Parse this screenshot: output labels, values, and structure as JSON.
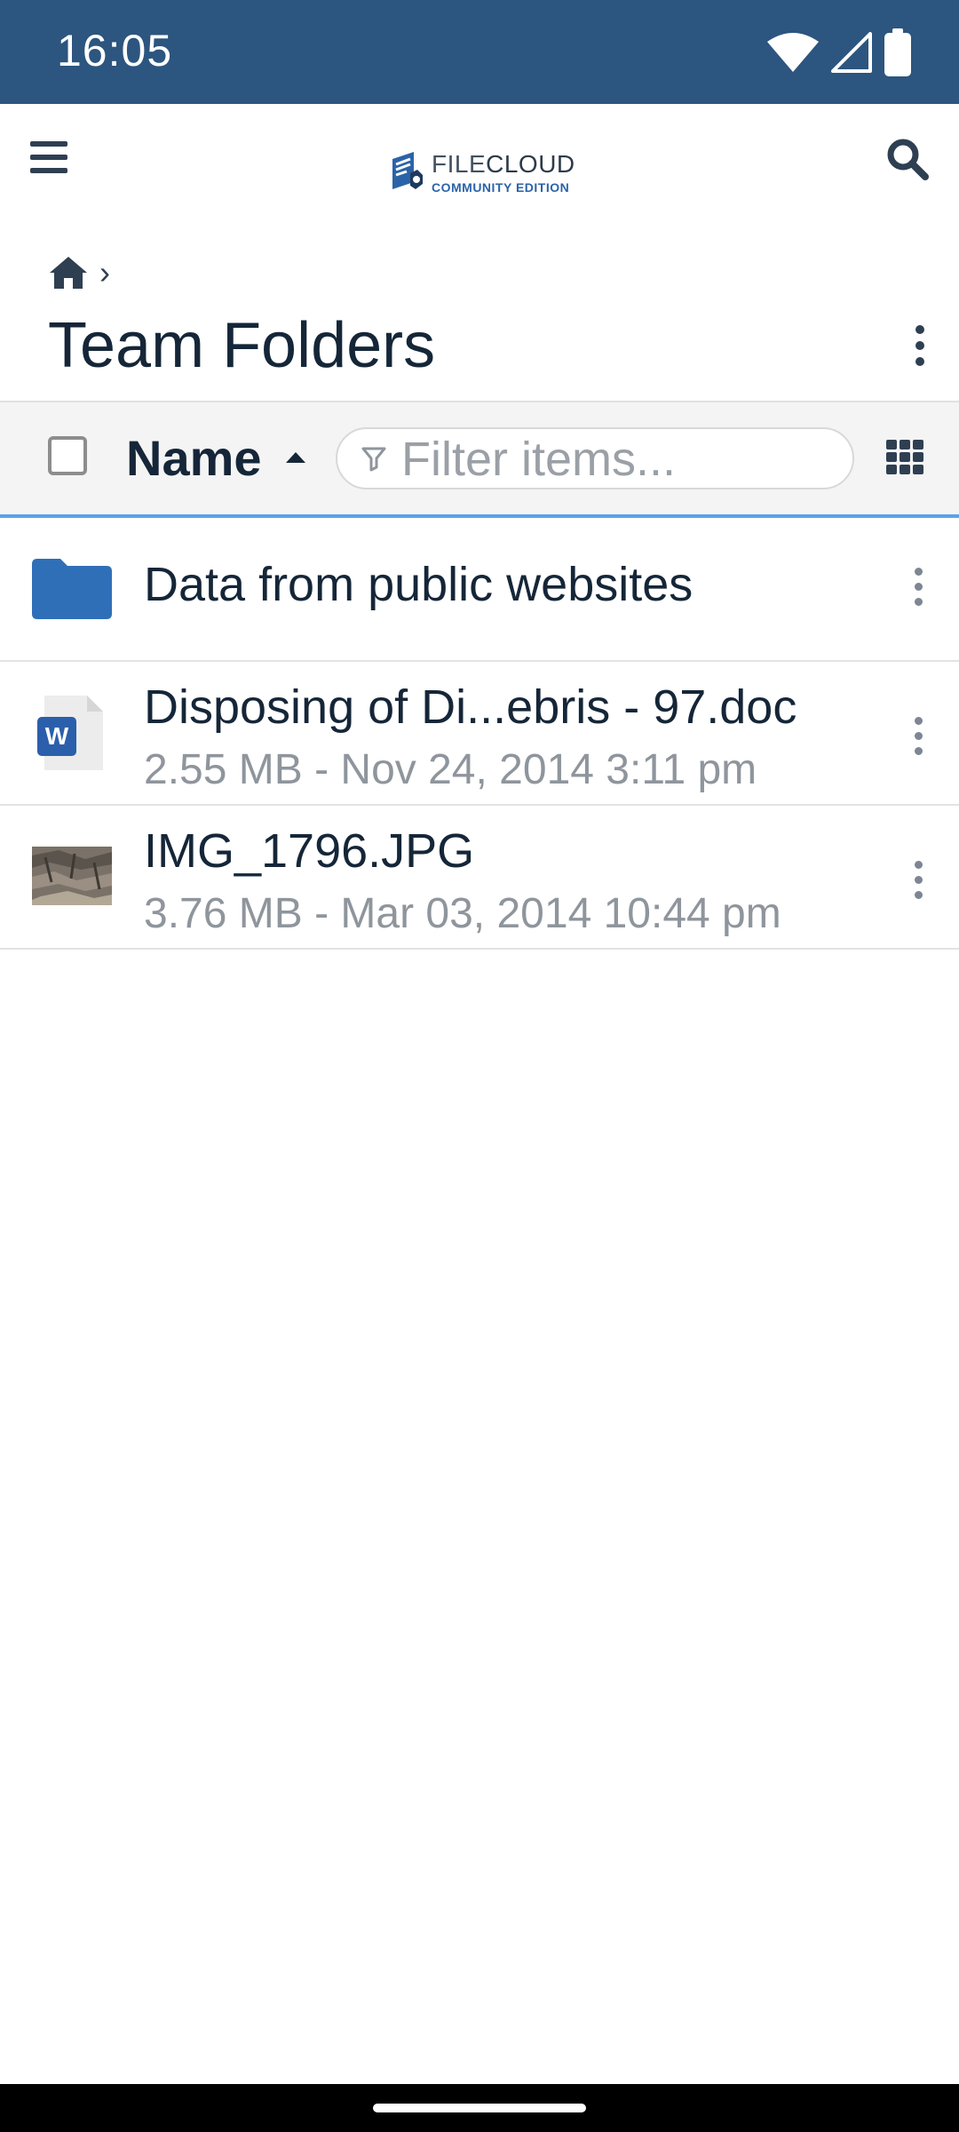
{
  "status_bar": {
    "time": "16:05"
  },
  "app_bar": {
    "logo_primary_light": "FILE",
    "logo_primary_bold": "CLOUD",
    "logo_secondary": "COMMUNITY EDITION"
  },
  "breadcrumb": {
    "separator": "›"
  },
  "page": {
    "title": "Team Folders"
  },
  "toolbar": {
    "sort_label": "Name",
    "filter_placeholder": "Filter items..."
  },
  "items": [
    {
      "name": "Data from public websites",
      "meta": "",
      "type": "folder"
    },
    {
      "name": "Disposing of Di...ebris - 97.doc",
      "meta": "2.55 MB - Nov 24, 2014 3:11 pm",
      "type": "word-document"
    },
    {
      "name": "IMG_1796.JPG",
      "meta": "3.76 MB - Mar 03, 2014 10:44 pm",
      "type": "image"
    }
  ],
  "colors": {
    "status_bar": "#2c557f",
    "accent": "#5aa3e5",
    "folder": "#2f6fb8",
    "text_primary": "#152638",
    "text_secondary": "#8f959c"
  }
}
